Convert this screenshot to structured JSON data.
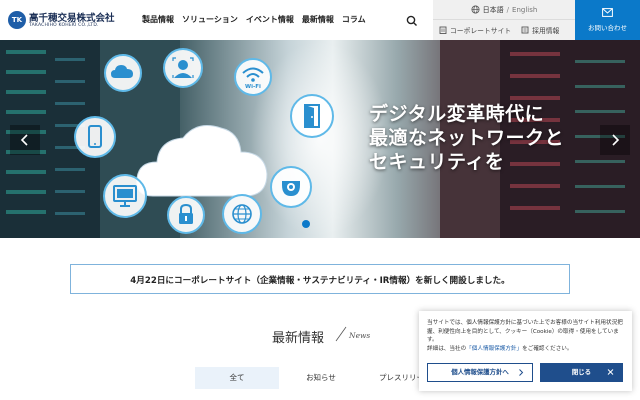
{
  "header": {
    "logo_mark": "TK",
    "logo_name": "高千穂交易株式会社",
    "logo_sub": "TAKACHIHO KOHEKI CO.,LTD.",
    "nav": [
      "製品情報",
      "ソリューション",
      "イベント情報",
      "最新情報",
      "コラム"
    ],
    "search_icon": "search-icon",
    "language": {
      "current": "日本語",
      "separator": "/",
      "alternate": "English"
    },
    "util_links": [
      "コーポレートサイト",
      "採用情報"
    ],
    "contact_label": "お問い合わせ"
  },
  "hero": {
    "headline": [
      "デジタル変革時代に",
      "最適なネットワークと",
      "セキュリティを"
    ],
    "icons": [
      "cloud-icon",
      "face-id-icon",
      "wifi-icon",
      "smartphone-icon",
      "door-icon",
      "monitor-icon",
      "camera-icon",
      "lock-icon",
      "globe-icon"
    ],
    "wifi_label": "Wi-Fi"
  },
  "announcement": {
    "text": "4月22日にコーポレートサイト（企業情報・サステナビリティ・IR情報）を新しく開設しました。"
  },
  "news": {
    "title": "最新情報",
    "subtitle": "News",
    "tabs": [
      "全て",
      "お知らせ",
      "プレスリリー"
    ]
  },
  "cookie": {
    "text_1": "当サイトでは、個人情報保護方針に基づいた上でお客様の当サイト利用状況把握、利便性向上を目的として、クッキー（Cookie）の取得・使用をしています。",
    "text_2_prefix": "詳細は、当社の",
    "text_2_link": "「個人情報保護方針」",
    "text_2_suffix": "をご確認ください。",
    "policy_button": "個人情報保護方針へ",
    "close_button": "閉じる"
  },
  "colors": {
    "brand_blue": "#0b79c9",
    "navy": "#1f4e8c",
    "announce_border": "#7fb3dc"
  }
}
